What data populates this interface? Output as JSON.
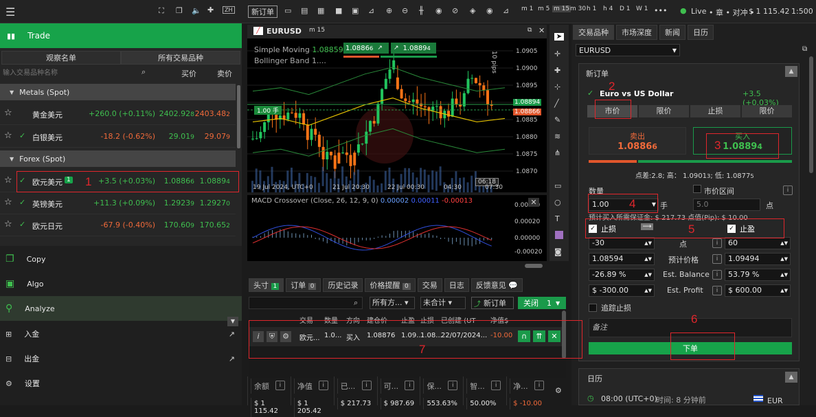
{
  "top": {
    "live": "Live",
    "status": "• 章 • 对冲 •",
    "balance": "$ 1 115.42",
    "ratio": "1:500",
    "new_order": "新订单",
    "timeframes": [
      "m 1",
      "m 5",
      "m 15",
      "m 30",
      "h 1",
      "h 4",
      "D 1",
      "W 1"
    ],
    "more": "•••"
  },
  "left": {
    "trade": "Trade",
    "tab_watch": "观察名单",
    "tab_all": "所有交易品种",
    "search_placeholder": "输入交易品种名称",
    "bid_h": "买价",
    "ask_h": "卖价",
    "groups": [
      "Metals (Spot)",
      "Forex (Spot)"
    ],
    "metals": [
      {
        "name": "黄金美元",
        "chg": "+260.0 (+0.11%)",
        "bid": "2402.92",
        "bid_s": "8",
        "ask": "2403.48",
        "ask_s": "2"
      },
      {
        "name": "白银美元",
        "chg": "-18.2 (-0.62%)",
        "bid": "29.01",
        "bid_s": "9",
        "ask": "29.07",
        "ask_s": "9"
      }
    ],
    "forex": [
      {
        "name": "欧元美元",
        "badge": "1",
        "chg": "+3.5 (+0.03%)",
        "bid": "1.0886",
        "bid_s": "6",
        "ask": "1.0889",
        "ask_s": "4"
      },
      {
        "name": "英镑美元",
        "chg": "+11.3 (+0.09%)",
        "bid": "1.2923",
        "bid_s": "9",
        "ask": "1.2927",
        "ask_s": "0"
      },
      {
        "name": "欧元日元",
        "chg": "-67.9 (-0.40%)",
        "bid": "170.60",
        "bid_s": "9",
        "ask": "170.65",
        "ask_s": "2"
      }
    ],
    "menu": [
      {
        "label": "Copy",
        "active": false
      },
      {
        "label": "Algo",
        "active": false
      },
      {
        "label": "Analyze",
        "active": true
      },
      {
        "label": "入金"
      },
      {
        "label": "出金"
      },
      {
        "label": "设置"
      }
    ]
  },
  "chart": {
    "symbol": "EURUSD",
    "tf": "m 15",
    "ind1": "Simple Moving",
    "ind1_v": "1.08859",
    "ind2": "Bollinger Band",
    "ind2_v": "1....",
    "sell": "1.0886",
    "sell_s": "6",
    "buy": "1.0889",
    "buy_s": "4",
    "pos_label": "1.00 手",
    "pips": "10 pips",
    "y": [
      "1.0905",
      "1.0900",
      "1.0895",
      "1.0890",
      "1.0885",
      "1.0880",
      "1.0875",
      "1.0870"
    ],
    "y_s": [
      "0",
      "0",
      "0",
      "0",
      "0",
      "0",
      "0",
      "0"
    ],
    "price_tag_g": "1.08894",
    "price_tag_r": "1.08866",
    "x": [
      "19 Jul 2024, UTC+0",
      "21 Jul 20:30",
      "22 Jul 00:30",
      "04:30",
      "07:30"
    ],
    "time_tag": "06:18",
    "macd": "MACD Crossover (Close, 26, 12, 9, 0)",
    "macd_v1": "0.00002",
    "macd_v2": "0.00011",
    "macd_v3": "-0.00013",
    "macd_y": [
      "0.00040",
      "0.00020",
      "0.00000",
      "-0.00020"
    ]
  },
  "chart_data": {
    "type": "line",
    "series": [
      {
        "name": "Simple Moving",
        "values": [
          1.0885,
          1.0886,
          1.0884,
          1.0887,
          1.089,
          1.0892,
          1.0889,
          1.0887,
          1.0885,
          1.0886
        ]
      }
    ],
    "ylim": [
      1.0868,
      1.0907
    ]
  },
  "bottom": {
    "tabs": [
      {
        "label": "头寸",
        "count": "1"
      },
      {
        "label": "订单",
        "count": "0"
      },
      {
        "label": "历史记录"
      },
      {
        "label": "价格提醒",
        "count": "0"
      },
      {
        "label": "交易"
      },
      {
        "label": "日志"
      },
      {
        "label": "反馈意见"
      }
    ],
    "filter1": "所有方...",
    "filter2": "未合计",
    "new_order": "新订单",
    "close": "关闭",
    "close_n": "1",
    "cols": [
      "交易",
      "数量",
      "方向",
      "建仓价",
      "止盈",
      "止损",
      "已创建 (UT",
      "净值$"
    ],
    "row": [
      "欧元...",
      "1.0...",
      "买入",
      "1.08876",
      "1.09...",
      "1.08...",
      "22/07/2024...",
      "-10.00"
    ],
    "balance": [
      {
        "k": "余额",
        "v": "$ 1 115.42"
      },
      {
        "k": "净值",
        "v": "$ 1 205.42"
      },
      {
        "k": "已...",
        "v": "$ 217.73"
      },
      {
        "k": "可...",
        "v": "$ 987.69"
      },
      {
        "k": "保...",
        "v": "553.63%"
      },
      {
        "k": "智...",
        "v": "50.00%"
      },
      {
        "k": "净...",
        "v": "$ -10.00"
      }
    ]
  },
  "right": {
    "tabs": [
      "交易品种",
      "市场深度",
      "新闻",
      "日历"
    ],
    "symbol": "EURUSD",
    "new_order": "新订单",
    "pair": "Euro vs US Dollar",
    "pair_chg": "+3.5 (+0.03%)",
    "types": [
      "市价",
      "限价",
      "止损",
      "限价"
    ],
    "sell": "卖出",
    "sell_v": "1.0886",
    "sell_s": "6",
    "buy": "买入",
    "buy_v": "1.0889",
    "buy_s": "4",
    "spread": "点差:2.8; 高： 1.0901",
    "spread_s": "3",
    "spread_low": "; 低: 1.0877",
    "spread_low_s": "5",
    "qty": "数量",
    "qty_v": "1.00",
    "lot": "手",
    "limit": "市价区间",
    "limit_v": "5.0",
    "pt": "点",
    "margin": "预计买入所需保证金: $ 217.73  点值(Pip): $ 10.00",
    "sl": "止损",
    "tp": "止盈",
    "sl_pts": "-30",
    "tp_pts": "60",
    "sl_price": "1.08594",
    "tp_price": "1.09494",
    "est_price": "预计价格",
    "sl_bal": "-26.89 %",
    "tp_bal": "53.79 %",
    "est_bal": "Est. Balance",
    "sl_profit": "$ -300.00",
    "tp_profit": "$ 600.00",
    "est_profit": "Est. Profit",
    "trail": "追踪止损",
    "note": "备注",
    "submit": "下单",
    "calendar": "日历",
    "cal_time": "08:00 (UTC+0)",
    "cal_rel": "时间: 8 分钟前",
    "cal_cur": "EUR"
  }
}
